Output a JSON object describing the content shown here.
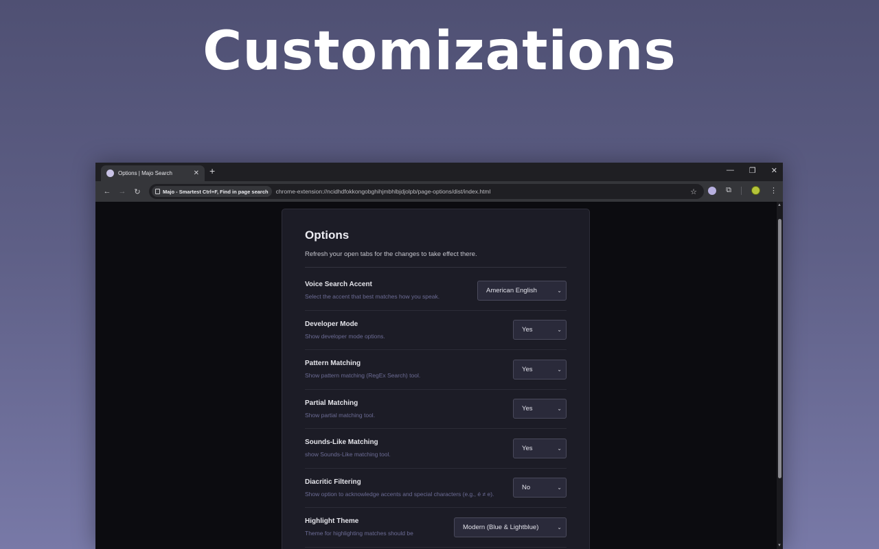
{
  "hero": {
    "title": "Customizations"
  },
  "browser": {
    "tab": {
      "title": "Options | Majo Search",
      "close": "✕"
    },
    "new_tab": "+",
    "window_controls": {
      "minimize": "—",
      "restore": "❐",
      "close": "✕"
    },
    "nav": {
      "back": "←",
      "forward": "→",
      "reload": "↻"
    },
    "site_chip": "Majo - Smartest Ctrl+F, Find in page search",
    "url": "chrome-extension://ncidhdfokkongobghihjmbhlbjdjolpb/page-options/dist/index.html",
    "star": "☆",
    "puzzle": "⧉",
    "menu": "⋮"
  },
  "options": {
    "title": "Options",
    "subtitle": "Refresh your open tabs for the changes to take effect there.",
    "rows": [
      {
        "label": "Voice Search Accent",
        "desc": "Select the accent that best matches how you speak.",
        "value": "American English"
      },
      {
        "label": "Developer Mode",
        "desc": "Show developer mode options.",
        "value": "Yes"
      },
      {
        "label": "Pattern Matching",
        "desc": "Show pattern matching (RegEx Search) tool.",
        "value": "Yes"
      },
      {
        "label": "Partial Matching",
        "desc": "Show partial matching tool.",
        "value": "Yes"
      },
      {
        "label": "Sounds-Like Matching",
        "desc": "show Sounds-Like matching tool.",
        "value": "Yes"
      },
      {
        "label": "Diacritic Filtering",
        "desc": "Show option to acknowledge accents and special characters (e.g., é ≠ e).",
        "value": "No"
      },
      {
        "label": "Highlight Theme",
        "desc": "Theme for highlighting matches should be",
        "value": "Modern (Blue & Lightblue)"
      }
    ]
  },
  "icons": {
    "chevron": "⌄",
    "scroll_up": "▲",
    "scroll_down": "▼"
  }
}
